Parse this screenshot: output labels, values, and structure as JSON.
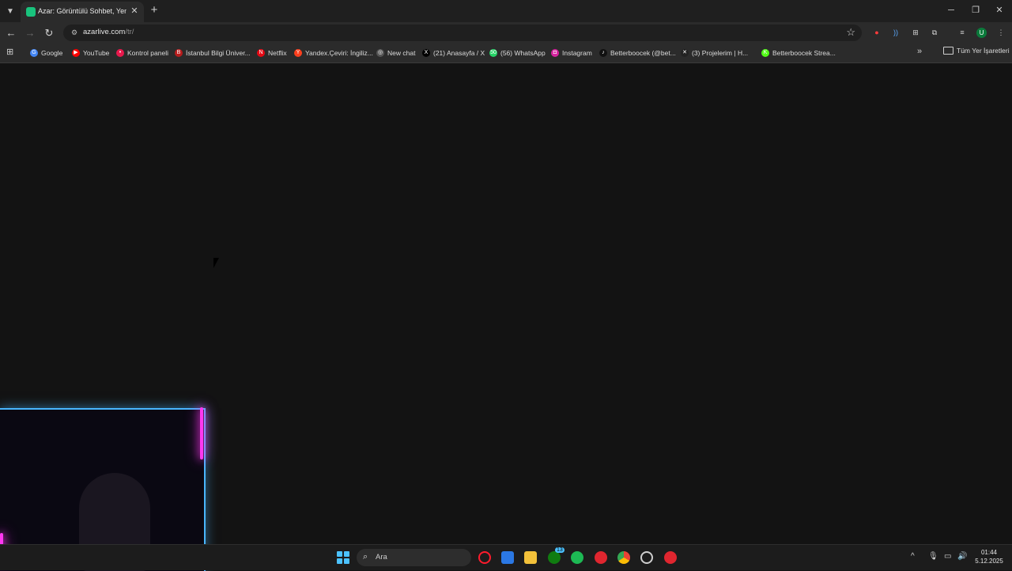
{
  "tab": {
    "title": "Azar: Görüntülü Sohbet, Yeni Ar",
    "close": "✕"
  },
  "new_tab": "+",
  "window": {
    "minimize": "─",
    "restore": "❐",
    "close": "✕"
  },
  "nav": {
    "back": "←",
    "forward": "→",
    "reload": "↻"
  },
  "omnibox": {
    "host": "azarlive.com",
    "path": "/tr/"
  },
  "star": "☆",
  "profile_initial": "U",
  "bookmarks": [
    {
      "label": "Google",
      "icon": "google-icon",
      "color": "#4285f4",
      "glyph": "G"
    },
    {
      "label": "YouTube",
      "icon": "youtube-icon",
      "color": "#ff0000",
      "glyph": "▶"
    },
    {
      "label": "Kontrol paneli",
      "icon": "panel-icon",
      "color": "#e8194c",
      "glyph": "•"
    },
    {
      "label": "İstanbul Bilgi Üniver...",
      "icon": "university-icon",
      "color": "#b71c1c",
      "glyph": "B"
    },
    {
      "label": "Netflix",
      "icon": "netflix-icon",
      "color": "#e50914",
      "glyph": "N"
    },
    {
      "label": "Yandex.Çeviri: İngiliz...",
      "icon": "yandex-icon",
      "color": "#fc3f1d",
      "glyph": "Y"
    },
    {
      "label": "New chat",
      "icon": "chatgpt-icon",
      "color": "#555555",
      "glyph": "◎"
    },
    {
      "label": "(21) Anasayfa / X",
      "icon": "x-icon",
      "color": "#000000",
      "glyph": "X"
    },
    {
      "label": "(56) WhatsApp",
      "icon": "whatsapp-icon",
      "color": "#25d366",
      "glyph": "50"
    },
    {
      "label": "Instagram",
      "icon": "instagram-icon",
      "color": "#d6249f",
      "glyph": "◘"
    },
    {
      "label": "Betterboocek (@bet...",
      "icon": "tiktok-icon",
      "color": "#111111",
      "glyph": "♪"
    },
    {
      "label": "(3) Projelerim | H...",
      "icon": "hackerrank-icon",
      "color": "#222222",
      "glyph": "✕"
    },
    {
      "label": "Betterboocek Strea...",
      "icon": "kick-icon",
      "color": "#53fc18",
      "glyph": "K"
    }
  ],
  "bookmarks_more": "»",
  "all_bookmarks": "Tüm Yer İşaretleri",
  "taskbar": {
    "search_label": "Ara",
    "xbox_badge": "13",
    "clock_time": "01:44",
    "clock_date": "5.12.2025"
  },
  "colors": {
    "accent_green": "#19c37d",
    "neon_pink": "#ff38f2",
    "neon_blue": "#49b6ff"
  }
}
